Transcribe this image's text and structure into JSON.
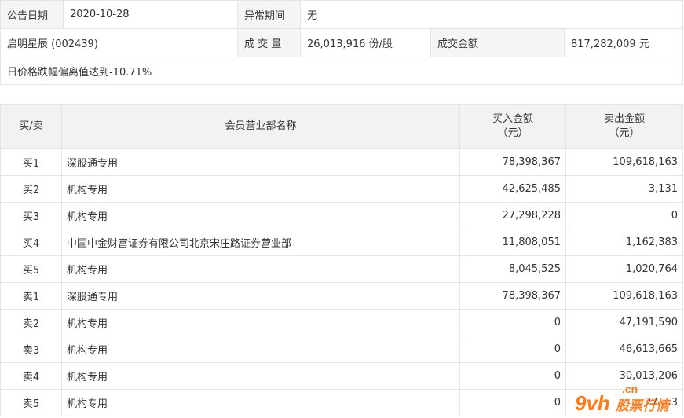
{
  "info": {
    "announce_date_label": "公告日期",
    "announce_date": "2020-10-28",
    "abnormal_period_label": "异常期间",
    "abnormal_period": "无",
    "stock": "启明星辰 (002439)",
    "volume_label": "成 交 量",
    "volume": "26,013,916 份/股",
    "amount_label": "成交金额",
    "amount": "817,282,009 元",
    "reason": "日价格跌幅偏离值达到-10.71%"
  },
  "trade": {
    "headers": {
      "side": "买/卖",
      "branch": "会员营业部名称",
      "buy_line1": "买入金额",
      "buy_line2": "（元）",
      "sell_line1": "卖出金额",
      "sell_line2": "（元）"
    },
    "rows": [
      {
        "side": "买1",
        "branch": "深股通专用",
        "buy": "78,398,367",
        "sell": "109,618,163"
      },
      {
        "side": "买2",
        "branch": "机构专用",
        "buy": "42,625,485",
        "sell": "3,131"
      },
      {
        "side": "买3",
        "branch": "机构专用",
        "buy": "27,298,228",
        "sell": "0"
      },
      {
        "side": "买4",
        "branch": "中国中金财富证券有限公司北京宋庄路证券营业部",
        "buy": "11,808,051",
        "sell": "1,162,383"
      },
      {
        "side": "买5",
        "branch": "机构专用",
        "buy": "8,045,525",
        "sell": "1,020,764"
      },
      {
        "side": "卖1",
        "branch": "深股通专用",
        "buy": "78,398,367",
        "sell": "109,618,163"
      },
      {
        "side": "卖2",
        "branch": "机构专用",
        "buy": "0",
        "sell": "47,191,590"
      },
      {
        "side": "卖3",
        "branch": "机构专用",
        "buy": "0",
        "sell": "46,613,665"
      },
      {
        "side": "卖4",
        "branch": "机构专用",
        "buy": "0",
        "sell": "30,013,206"
      },
      {
        "side": "卖5",
        "branch": "机构专用",
        "buy": "0",
        "sell": "27,…3"
      }
    ]
  },
  "watermark": {
    "logo_text": "9vh",
    "domain_text": ".cn",
    "brand_text": "股票行情",
    "brand_color": "#ff6a00"
  }
}
